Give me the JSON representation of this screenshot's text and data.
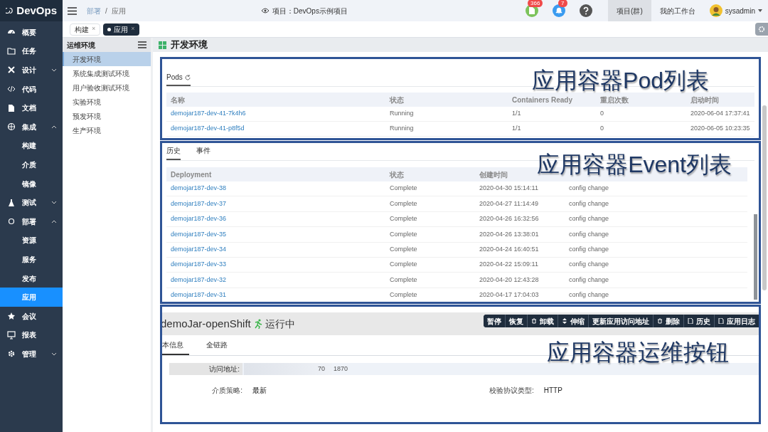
{
  "app": {
    "title": "DevOps"
  },
  "sidebar": {
    "items": [
      {
        "label": "概要"
      },
      {
        "label": "任务"
      },
      {
        "label": "设计",
        "expanded": false
      },
      {
        "label": "代码"
      },
      {
        "label": "文档"
      },
      {
        "label": "集成",
        "expanded": true,
        "children": [
          {
            "label": "构建",
            "selected": false
          },
          {
            "label": "介质",
            "selected": false
          },
          {
            "label": "镜像",
            "selected": false
          }
        ]
      },
      {
        "label": "测试",
        "expanded": false
      },
      {
        "label": "部署",
        "expanded": true,
        "children": [
          {
            "label": "资源",
            "selected": false
          },
          {
            "label": "服务",
            "selected": false
          },
          {
            "label": "发布",
            "selected": false
          },
          {
            "label": "应用",
            "selected": true
          }
        ]
      },
      {
        "label": "会议"
      },
      {
        "label": "报表"
      },
      {
        "label": "管理",
        "expanded": false
      }
    ]
  },
  "breadcrumb": [
    "部署",
    "/",
    "应用"
  ],
  "project": "项目：DevOps示例项目",
  "header": {
    "doc_badge": "366",
    "bell_badge": "7",
    "tabs": [
      {
        "label": "项目(群)",
        "selected": true
      },
      {
        "label": "我的工作台",
        "selected": false
      }
    ],
    "user": "sysadmin"
  },
  "page_tabs": [
    {
      "label": "构建",
      "selected": false,
      "close": "×"
    },
    {
      "label": "应用",
      "selected": true,
      "close": "×"
    }
  ],
  "env_panel": {
    "title": "运维环境",
    "items": [
      {
        "label": "开发环境",
        "selected": true
      },
      {
        "label": "系统集成测试环境",
        "selected": false
      },
      {
        "label": "用户验收测试环境",
        "selected": false
      },
      {
        "label": "实验环境",
        "selected": false
      },
      {
        "label": "预发环境",
        "selected": false
      },
      {
        "label": "生产环境",
        "selected": false
      }
    ]
  },
  "main_title": "开发环境",
  "pods": {
    "tab": "Pods",
    "annotation": "应用容器Pod列表",
    "columns": [
      "名称",
      "状态",
      "Containers Ready",
      "重启次数",
      "启动时间"
    ],
    "rows": [
      [
        "demojar187-dev-41-7k4h6",
        "Running",
        "1/1",
        "0",
        "2020-06-04 17:37:41"
      ],
      [
        "demojar187-dev-41-p8f5d",
        "Running",
        "1/1",
        "0",
        "2020-06-05 10:23:35"
      ]
    ]
  },
  "events": {
    "tabs": [
      {
        "label": "历史",
        "selected": true
      },
      {
        "label": "事件",
        "selected": false
      }
    ],
    "annotation": "应用容器Event列表",
    "columns": [
      "Deployment",
      "状态",
      "创建时间"
    ],
    "rows": [
      [
        "demojar187-dev-38",
        "Complete",
        "2020-04-30 15:14:11",
        "config change"
      ],
      [
        "demojar187-dev-37",
        "Complete",
        "2020-04-27 11:14:49",
        "config change"
      ],
      [
        "demojar187-dev-36",
        "Complete",
        "2020-04-26 16:32:56",
        "config change"
      ],
      [
        "demojar187-dev-35",
        "Complete",
        "2020-04-26 13:38:01",
        "config change"
      ],
      [
        "demojar187-dev-34",
        "Complete",
        "2020-04-24 16:40:51",
        "config change"
      ],
      [
        "demojar187-dev-33",
        "Complete",
        "2020-04-22 15:09:11",
        "config change"
      ],
      [
        "demojar187-dev-32",
        "Complete",
        "2020-04-20 12:43:28",
        "config change"
      ],
      [
        "demojar187-dev-31",
        "Complete",
        "2020-04-17 17:04:03",
        "config change"
      ]
    ]
  },
  "app_panel": {
    "name": "demoJar-openShift",
    "status": "运行中",
    "annotation": "应用容器运维按钮",
    "buttons": [
      {
        "label": "暂停",
        "kind": "plain"
      },
      {
        "label": "恢复",
        "kind": "plain"
      },
      {
        "label": "卸载",
        "kind": "trash"
      },
      {
        "label": "伸缩",
        "kind": "scale"
      },
      {
        "label": "更新应用访问地址",
        "kind": "plain"
      },
      {
        "label": "删除",
        "kind": "trash"
      },
      {
        "label": "历史",
        "kind": "file"
      },
      {
        "label": "应用日志",
        "kind": "file"
      }
    ],
    "tabs": [
      {
        "label": "本信息",
        "selected": true
      },
      {
        "label": "全链路",
        "selected": false
      }
    ],
    "address_label": "访问地址:",
    "address_parts": [
      "70",
      "1870"
    ],
    "fields": [
      {
        "label": "介质策略:",
        "value": "最新"
      },
      {
        "label": "校验协议类型:",
        "value": "HTTP"
      }
    ]
  }
}
